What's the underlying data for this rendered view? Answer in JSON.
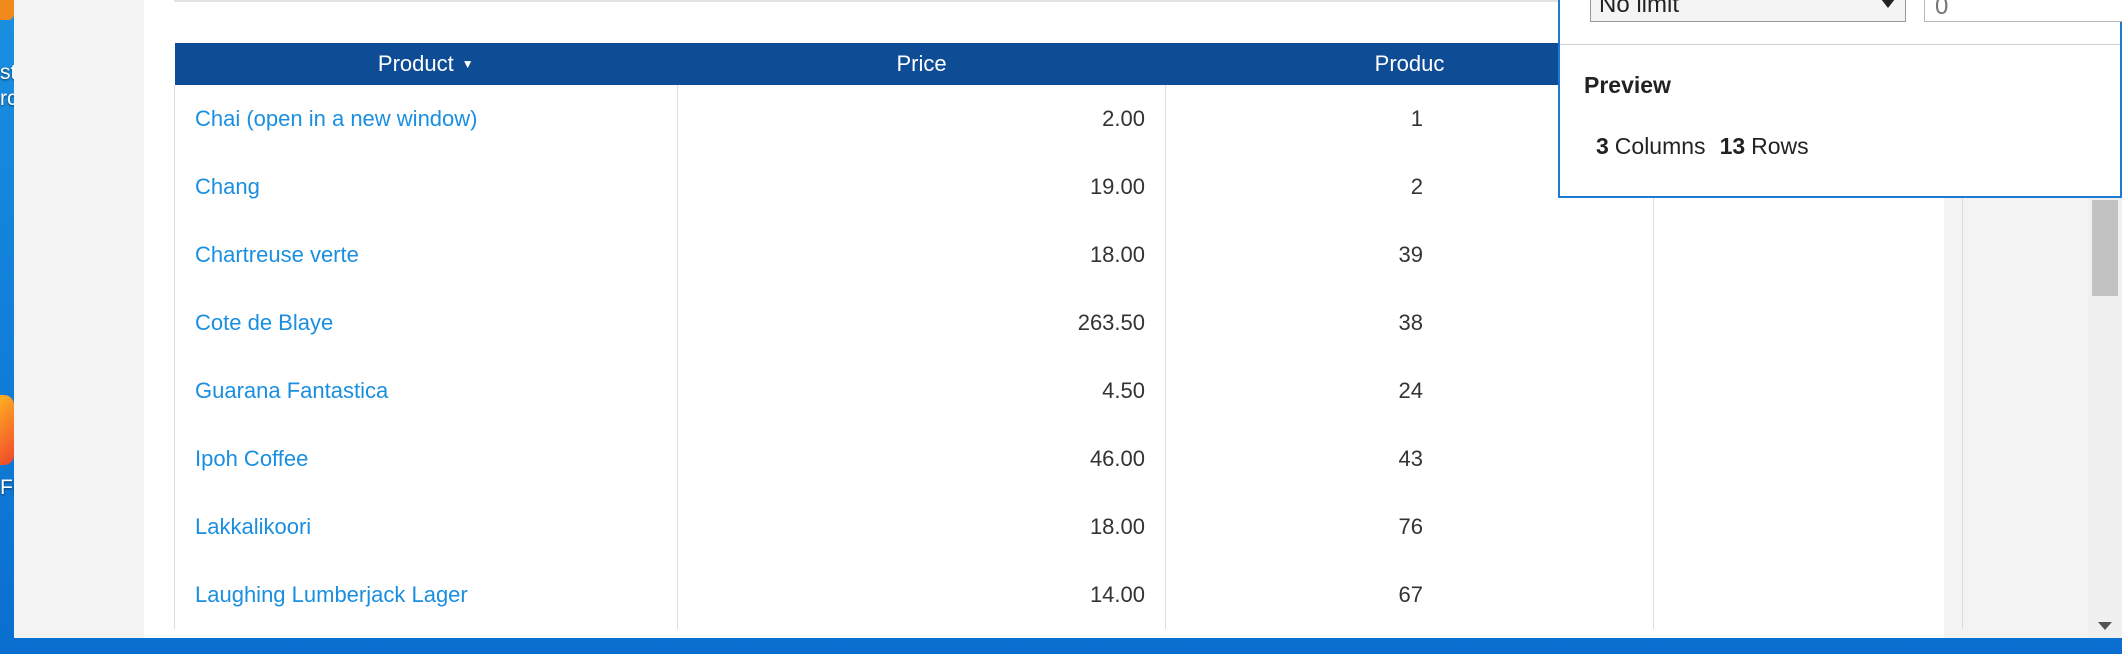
{
  "desktop": {
    "label_1": "st\nrc",
    "label_2": "Fi"
  },
  "table": {
    "columns": [
      {
        "label": "Product",
        "sorted": true
      },
      {
        "label": "Price"
      },
      {
        "label": "Produc"
      },
      {
        "label": ""
      }
    ],
    "rows": [
      {
        "product": "Chai  (open in a new window)",
        "price": "2.00",
        "id": "1"
      },
      {
        "product": "Chang",
        "price": "19.00",
        "id": "2"
      },
      {
        "product": "Chartreuse verte",
        "price": "18.00",
        "id": "39"
      },
      {
        "product": "Cote de Blaye",
        "price": "263.50",
        "id": "38"
      },
      {
        "product": "Guarana Fantastica",
        "price": "4.50",
        "id": "24"
      },
      {
        "product": "Ipoh Coffee",
        "price": "46.00",
        "id": "43"
      },
      {
        "product": "Lakkalikoori",
        "price": "18.00",
        "id": "76"
      },
      {
        "product": "Laughing Lumberjack Lager",
        "price": "14.00",
        "id": "67"
      }
    ]
  },
  "popup": {
    "limit_select_value": "No limit",
    "limit_input_placeholder": "0",
    "preview_title": "Preview",
    "columns_count": "3",
    "columns_label": "Columns",
    "rows_count": "13",
    "rows_label": "Rows"
  },
  "colors": {
    "header_bg": "#0f4c96",
    "link": "#1a8fe0",
    "popup_border": "#1a7ad6"
  }
}
